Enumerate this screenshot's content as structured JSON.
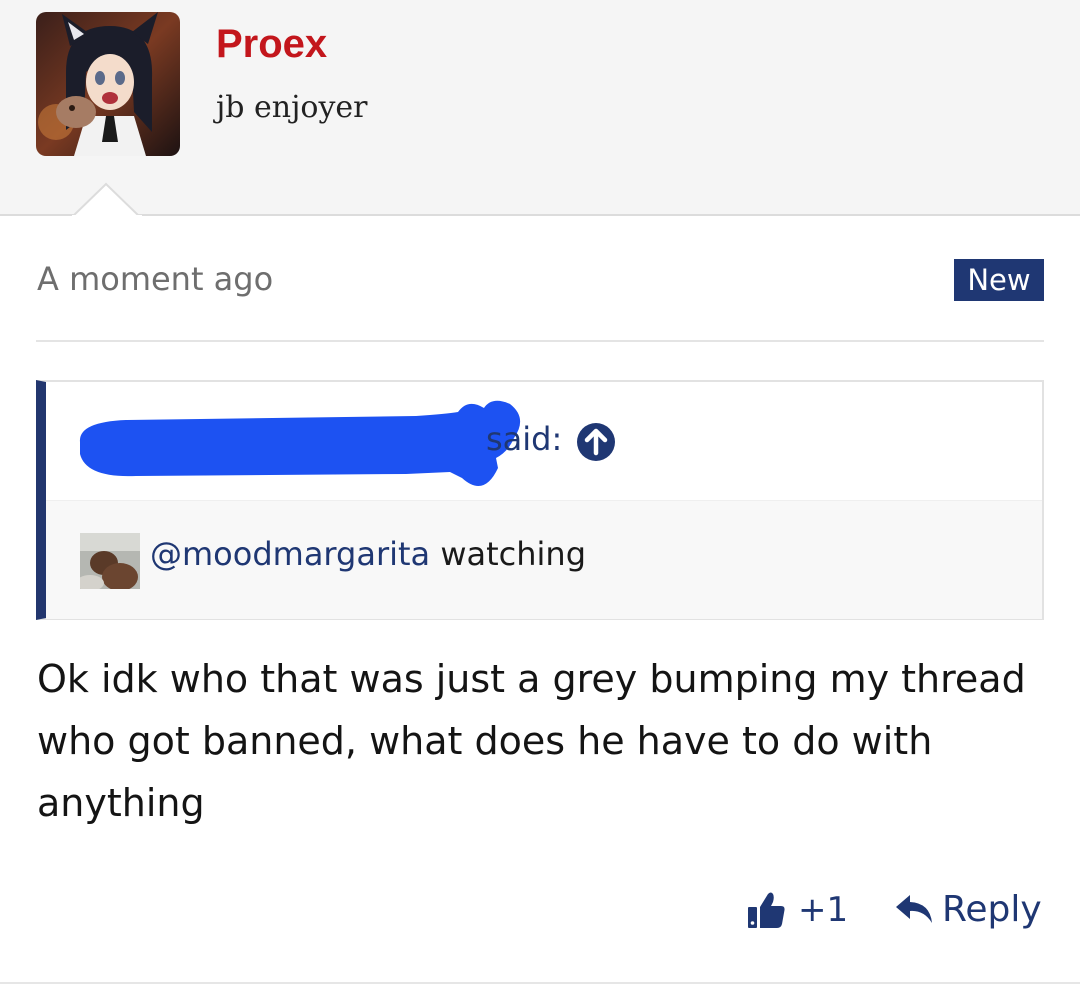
{
  "user": {
    "name": "Proex",
    "title": "jb enjoyer",
    "name_color": "#c3161c"
  },
  "post": {
    "date": "A moment ago",
    "badge": "New",
    "body": "Ok idk who that was just a grey bumping my thread who got banned, what does he have to do with anything"
  },
  "quote": {
    "author_redacted": true,
    "said_label": "said:",
    "mention": "@moodmargarita",
    "text": " watching"
  },
  "actions": {
    "like_count": "+1",
    "reply_label": "Reply"
  },
  "colors": {
    "accent": "#1f3773",
    "redaction": "#1d52f2",
    "header_bg": "#f5f5f5"
  },
  "icons": [
    "avatar-image",
    "arrow-up-icon",
    "thumbs-up-icon",
    "reply-icon"
  ]
}
